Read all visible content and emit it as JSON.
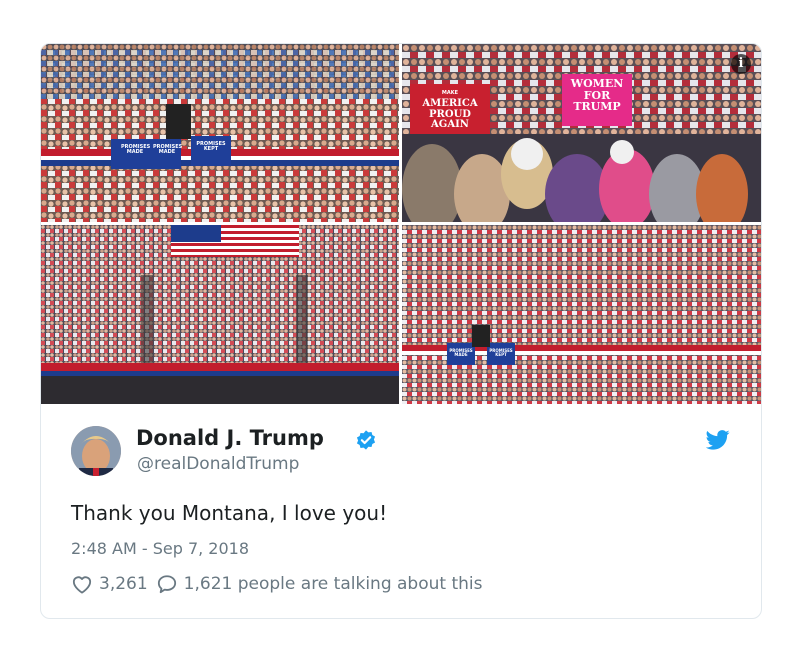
{
  "tweet": {
    "display_name": "Donald J. Trump",
    "handle": "@realDonaldTrump",
    "text": "Thank you Montana, I love you!",
    "timestamp": "2:48 AM - Sep 7, 2018",
    "likes": "3,261",
    "conversation": "1,621 people are talking about this"
  },
  "photos": {
    "info_icon": "i",
    "p1_signs": [
      "PROMISES MADE",
      "PROMISES MADE",
      "PROMISES KEPT"
    ],
    "p2_sign_left_top": "MAKE",
    "p2_sign_left": "AMERICA PROUD AGAIN",
    "p2_sign_right": "WOMEN FOR TRUMP",
    "p4_signs": [
      "PROMISES MADE",
      "PROMISES KEPT"
    ]
  },
  "colors": {
    "twitter_blue": "#1da1f2",
    "name": "#1c2022",
    "secondary": "#697882",
    "border": "#e1e8ed",
    "sign_blue": "#1f3f99",
    "sign_pink": "#e52b89",
    "sign_red": "#c8202f"
  },
  "icons": [
    "info-icon",
    "verified-badge-icon",
    "twitter-bird-icon",
    "heart-icon",
    "comment-bubble-icon"
  ]
}
